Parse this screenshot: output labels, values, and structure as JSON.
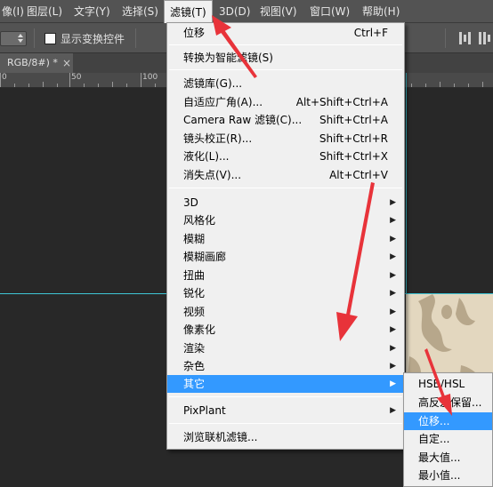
{
  "menubar": {
    "items": [
      {
        "label": "像(I)"
      },
      {
        "label": "图层(L)"
      },
      {
        "label": "文字(Y)"
      },
      {
        "label": "选择(S)"
      },
      {
        "label": "滤镜(T)"
      },
      {
        "label": "3D(D)"
      },
      {
        "label": "视图(V)"
      },
      {
        "label": "窗口(W)"
      },
      {
        "label": "帮助(H)"
      }
    ],
    "active": "滤镜(T)"
  },
  "options_bar": {
    "checkbox_label": "显示变换控件",
    "checkbox_checked": false
  },
  "document_tab": {
    "label": "RGB/8#) *",
    "close": "×"
  },
  "ruler": {
    "labels": [
      "0",
      "50",
      "100"
    ]
  },
  "filter_menu": {
    "last_filter": {
      "label": "位移",
      "shortcut": "Ctrl+F"
    },
    "smart_filter": {
      "label": "转换为智能滤镜(S)"
    },
    "group1": [
      {
        "label": "滤镜库(G)...",
        "shortcut": ""
      },
      {
        "label": "自适应广角(A)...",
        "shortcut": "Alt+Shift+Ctrl+A"
      },
      {
        "label": "Camera Raw 滤镜(C)...",
        "shortcut": "Shift+Ctrl+A"
      },
      {
        "label": "镜头校正(R)...",
        "shortcut": "Shift+Ctrl+R"
      },
      {
        "label": "液化(L)...",
        "shortcut": "Shift+Ctrl+X"
      },
      {
        "label": "消失点(V)...",
        "shortcut": "Alt+Ctrl+V"
      }
    ],
    "submenus": [
      {
        "label": "3D"
      },
      {
        "label": "风格化"
      },
      {
        "label": "模糊"
      },
      {
        "label": "模糊画廊"
      },
      {
        "label": "扭曲"
      },
      {
        "label": "锐化"
      },
      {
        "label": "视频"
      },
      {
        "label": "像素化"
      },
      {
        "label": "渲染"
      },
      {
        "label": "杂色"
      },
      {
        "label": "其它"
      }
    ],
    "highlighted": "其它",
    "plugins": [
      {
        "label": "PixPlant"
      }
    ],
    "browse": {
      "label": "浏览联机滤镜..."
    },
    "arrow_glyph": "▶"
  },
  "other_submenu": {
    "items": [
      {
        "label": "HSB/HSL"
      },
      {
        "label": "高反差保留..."
      },
      {
        "label": "位移..."
      },
      {
        "label": "自定..."
      },
      {
        "label": "最大值..."
      },
      {
        "label": "最小值..."
      }
    ],
    "highlighted": "位移..."
  },
  "colors": {
    "highlight": "#3399ff",
    "menu_bg": "#f0f0f0",
    "annotation_arrow": "#e8333a",
    "guide": "#3ec6d6",
    "workspace_bg": "#282828"
  }
}
